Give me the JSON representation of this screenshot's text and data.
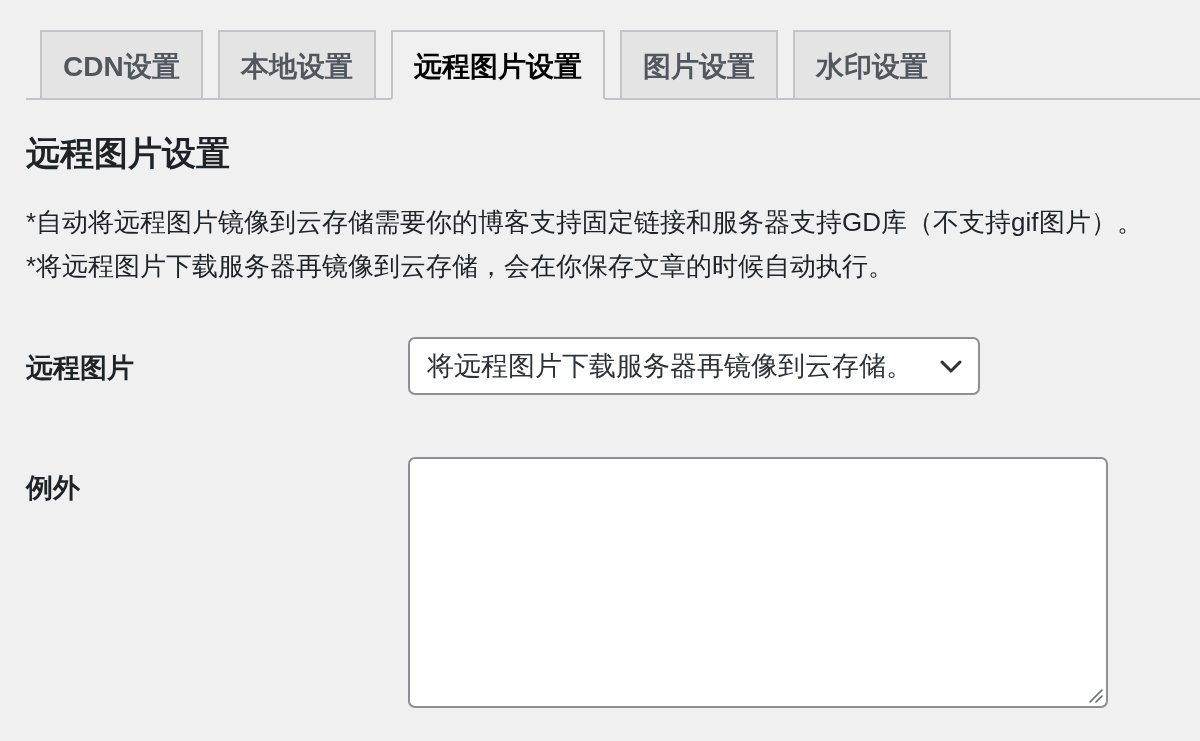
{
  "tabs": [
    {
      "label": "CDN设置",
      "selected": false
    },
    {
      "label": "本地设置",
      "selected": false
    },
    {
      "label": "远程图片设置",
      "selected": true
    },
    {
      "label": "图片设置",
      "selected": false
    },
    {
      "label": "水印设置",
      "selected": false
    }
  ],
  "section": {
    "title": "远程图片设置",
    "notes": [
      "*自动将远程图片镜像到云存储需要你的博客支持固定链接和服务器支持GD库（不支持gif图片）。",
      "*将远程图片下载服务器再镜像到云存储，会在你保存文章的时候自动执行。"
    ]
  },
  "fields": [
    {
      "kind": "select",
      "label": "远程图片",
      "value": "将远程图片下载服务器再镜像到云存储。"
    },
    {
      "kind": "textarea",
      "label": "例外"
    }
  ]
}
